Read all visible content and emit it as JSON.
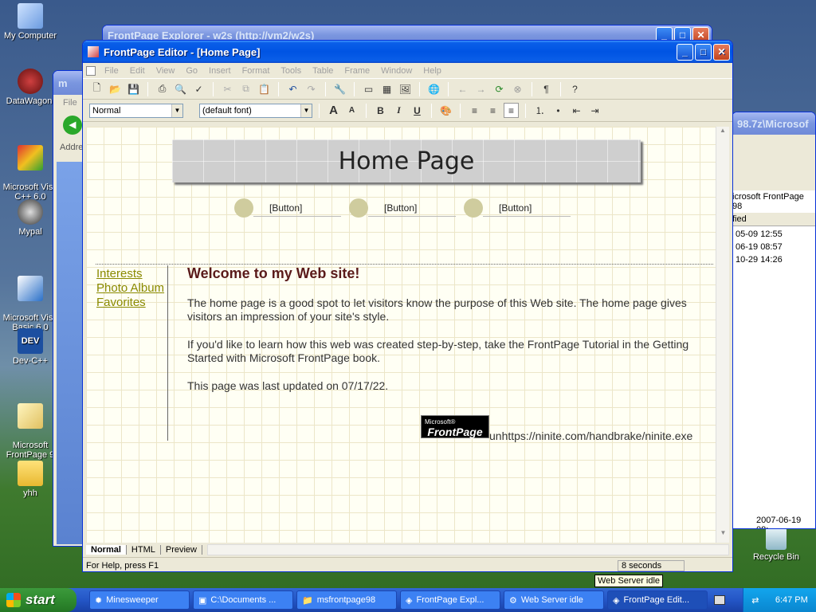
{
  "desktop_icons": [
    {
      "label": "My Computer",
      "icon": "computer-icon"
    },
    {
      "label": "DataWagon.",
      "icon": "network-icon"
    },
    {
      "label": "Microsoft Visu\nC++ 6.0",
      "icon": "visual-cpp-icon"
    },
    {
      "label": "Mypal",
      "icon": "browser-icon"
    },
    {
      "label": "Microsoft Visu\nBasic 6.0",
      "icon": "visual-basic-icon"
    },
    {
      "label": "Dev-C++",
      "icon": "devcpp-icon"
    },
    {
      "label": "Microsoft\nFrontPage 9",
      "icon": "frontpage-icon"
    },
    {
      "label": "yhh",
      "icon": "folder-icon"
    },
    {
      "label": "Recycle Bin",
      "icon": "recycle-bin-icon"
    }
  ],
  "back_windows": {
    "explorer_title": "FrontPage Explorer - w2s (http://vm2/w2s)",
    "left_window_title": "m",
    "left_window_menu": "File",
    "left_window_address": "Addre",
    "right_window_title": "98.7z\\Microsof",
    "right_window_header": "icrosoft FrontPage 98",
    "right_window_col": "fied",
    "right_window_dates": [
      "05-09 12:55",
      "06-19 08:57",
      "10-29 14:26"
    ],
    "right_window_status": "2007-06-19 08:"
  },
  "editor": {
    "title": "FrontPage Editor - [Home Page]",
    "menu": [
      "File",
      "Edit",
      "View",
      "Go",
      "Insert",
      "Format",
      "Tools",
      "Table",
      "Frame",
      "Window",
      "Help"
    ],
    "style_select": "Normal",
    "font_select": "(default font)",
    "tabs": [
      "Normal",
      "HTML",
      "Preview"
    ],
    "status_help": "For Help, press F1",
    "status_time": "8 seconds"
  },
  "page": {
    "banner": "Home Page",
    "nav_buttons": [
      "[Button]",
      "[Button]",
      "[Button]"
    ],
    "left_links": [
      "Interests",
      "Photo Album",
      "Favorites"
    ],
    "heading": "Welcome to my Web site!",
    "para1": "The home page is a good spot to let visitors know the purpose of this Web site. The home page gives visitors an impression of your site's style.",
    "para2": "If you'd like to learn how this web was created step-by-step, take the FrontPage Tutorial in the Getting Started with Microsoft FrontPage book.",
    "para3": "This page was last updated on 07/17/22.",
    "logo_small": "Microsoft®",
    "logo_big": "FrontPage",
    "url_text": "unhttps://ninite.com/handbrake/ninite.exe"
  },
  "taskbar": {
    "start": "start",
    "tasks": [
      "Minesweeper",
      "C:\\Documents ...",
      "msfrontpage98",
      "FrontPage Expl...",
      "Web Server idle",
      "FrontPage Edit..."
    ],
    "clock": "6:47 PM",
    "tooltip": "Web Server idle"
  }
}
